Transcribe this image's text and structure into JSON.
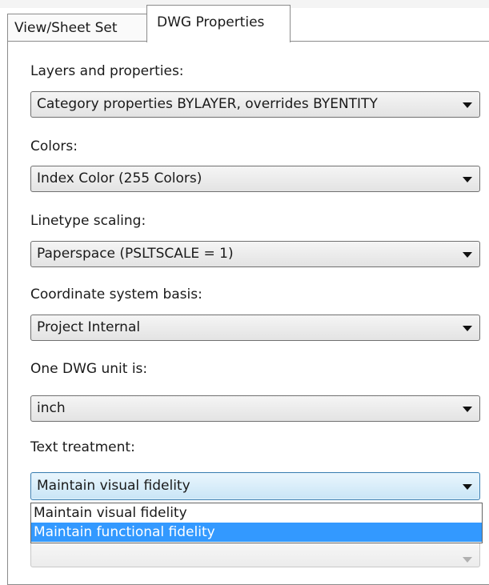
{
  "tabs": [
    {
      "label": "View/Sheet Set"
    },
    {
      "label": "DWG Properties"
    }
  ],
  "fields": {
    "layers": {
      "label": "Layers and properties:",
      "value": "Category properties BYLAYER, overrides BYENTITY"
    },
    "colors": {
      "label": "Colors:",
      "value": "Index Color (255 Colors)"
    },
    "linetype": {
      "label": "Linetype scaling:",
      "value": "Paperspace (PSLTSCALE = 1)"
    },
    "coord": {
      "label": "Coordinate system basis:",
      "value": "Project Internal"
    },
    "unit": {
      "label": "One DWG unit is:",
      "value": "inch"
    },
    "text": {
      "label": "Text treatment:",
      "value": "Maintain visual fidelity"
    }
  },
  "text_dropdown": {
    "options": [
      "Maintain visual fidelity",
      "Maintain functional fidelity"
    ],
    "highlighted": "Maintain functional fidelity"
  }
}
